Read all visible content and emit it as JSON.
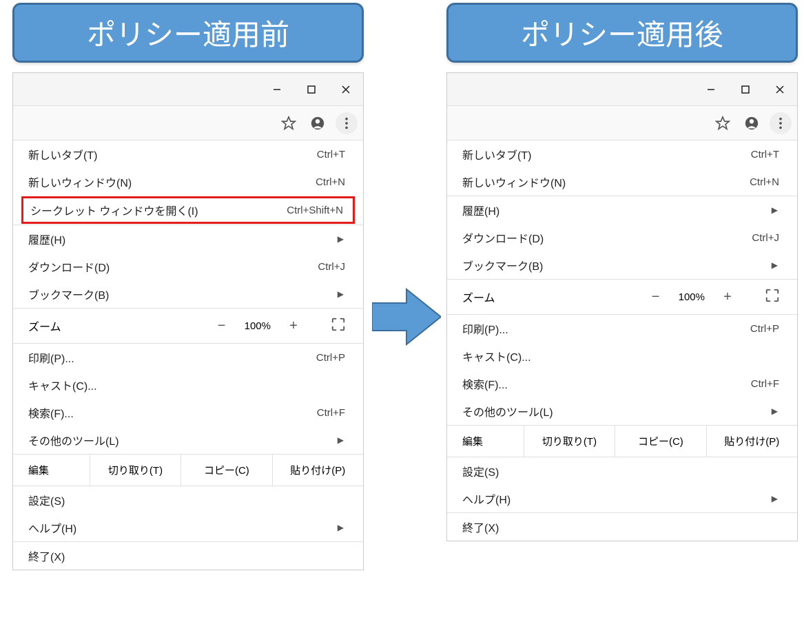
{
  "titles": {
    "before": "ポリシー適用前",
    "after": "ポリシー適用後"
  },
  "window_controls": {
    "minimize": "—",
    "maximize": "☐",
    "close": "✕"
  },
  "menu_before": {
    "new_tab": "新しいタブ(T)",
    "new_tab_sc": "Ctrl+T",
    "new_window": "新しいウィンドウ(N)",
    "new_window_sc": "Ctrl+N",
    "incognito": "シークレット ウィンドウを開く(I)",
    "incognito_sc": "Ctrl+Shift+N",
    "history": "履歴(H)",
    "downloads": "ダウンロード(D)",
    "downloads_sc": "Ctrl+J",
    "bookmarks": "ブックマーク(B)",
    "zoom": "ズーム",
    "zoom_value": "100%",
    "print": "印刷(P)...",
    "print_sc": "Ctrl+P",
    "cast": "キャスト(C)...",
    "find": "検索(F)...",
    "find_sc": "Ctrl+F",
    "more_tools": "その他のツール(L)",
    "edit": "編集",
    "cut": "切り取り(T)",
    "copy": "コピー(C)",
    "paste": "貼り付け(P)",
    "settings": "設定(S)",
    "help": "ヘルプ(H)",
    "exit": "終了(X)"
  },
  "menu_after": {
    "new_tab": "新しいタブ(T)",
    "new_tab_sc": "Ctrl+T",
    "new_window": "新しいウィンドウ(N)",
    "new_window_sc": "Ctrl+N",
    "history": "履歴(H)",
    "downloads": "ダウンロード(D)",
    "downloads_sc": "Ctrl+J",
    "bookmarks": "ブックマーク(B)",
    "zoom": "ズーム",
    "zoom_value": "100%",
    "print": "印刷(P)...",
    "print_sc": "Ctrl+P",
    "cast": "キャスト(C)...",
    "find": "検索(F)...",
    "find_sc": "Ctrl+F",
    "more_tools": "その他のツール(L)",
    "edit": "編集",
    "cut": "切り取り(T)",
    "copy": "コピー(C)",
    "paste": "貼り付け(P)",
    "settings": "設定(S)",
    "help": "ヘルプ(H)",
    "exit": "終了(X)"
  }
}
